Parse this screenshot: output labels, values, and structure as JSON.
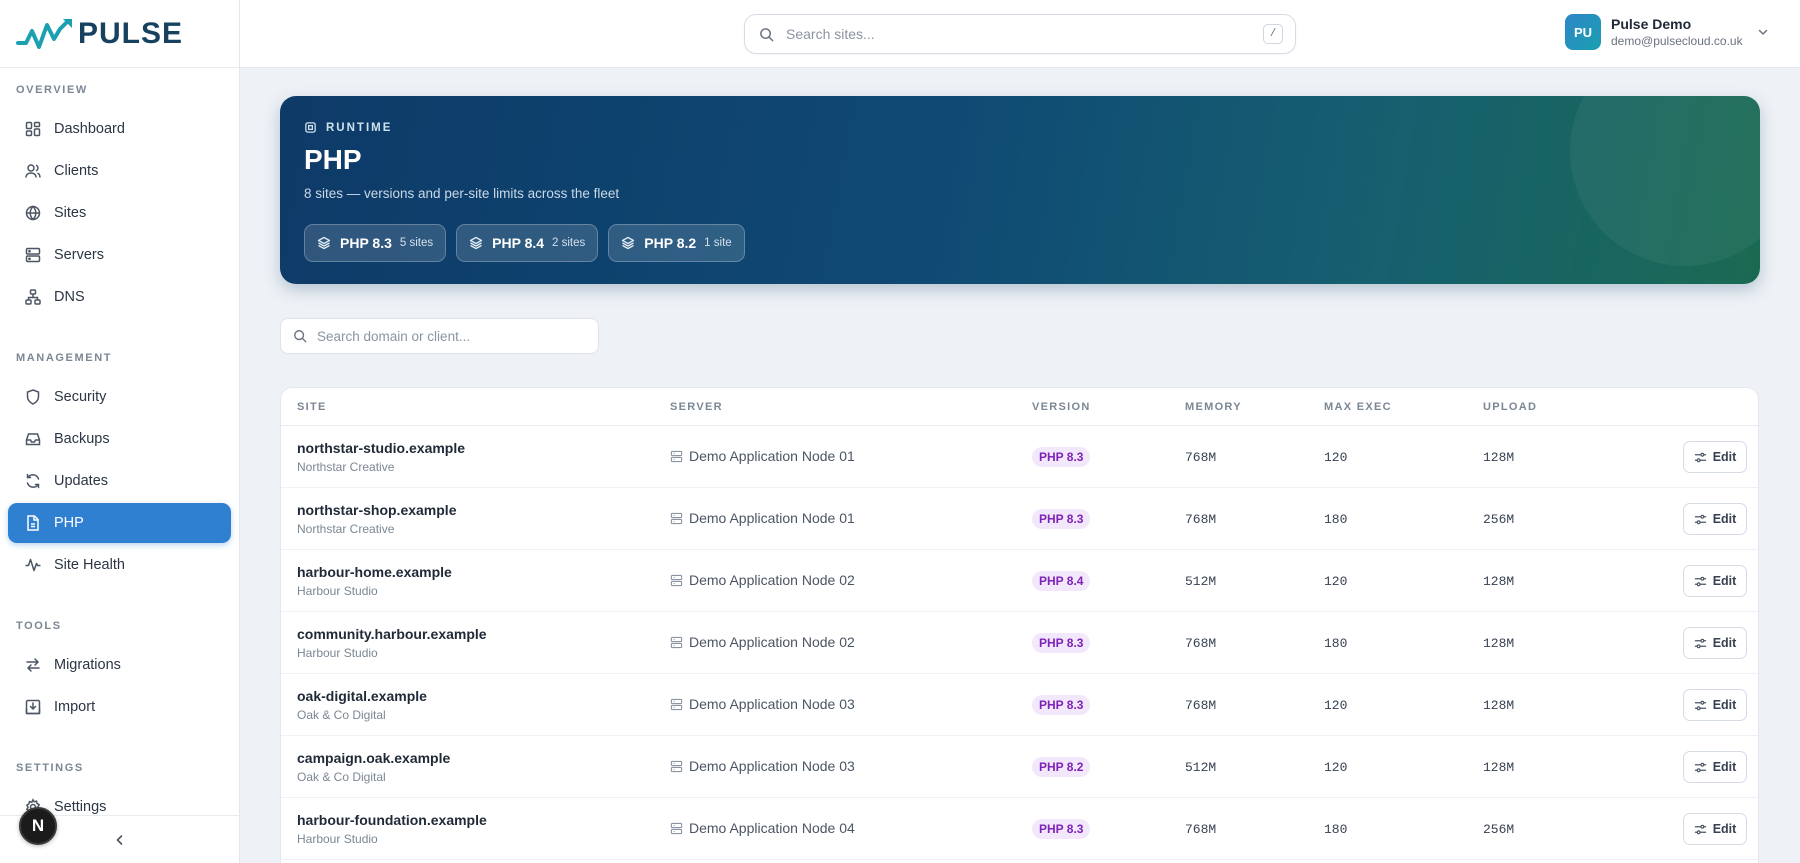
{
  "brand": {
    "name": "PULSE",
    "colors": {
      "primary": "#2f80d1",
      "navy": "#16415f",
      "teal": "#1aa0b0",
      "badge_bg": "#f3e8fb",
      "badge_text": "#7e22b8"
    }
  },
  "sidebar": {
    "sections": [
      {
        "label": "OVERVIEW",
        "items": [
          {
            "label": "Dashboard",
            "icon": "grid-icon"
          },
          {
            "label": "Clients",
            "icon": "users-icon"
          },
          {
            "label": "Sites",
            "icon": "globe-icon"
          },
          {
            "label": "Servers",
            "icon": "server-icon"
          },
          {
            "label": "DNS",
            "icon": "network-icon"
          }
        ]
      },
      {
        "label": "MANAGEMENT",
        "items": [
          {
            "label": "Security",
            "icon": "shield-icon"
          },
          {
            "label": "Backups",
            "icon": "archive-icon"
          },
          {
            "label": "Updates",
            "icon": "refresh-icon"
          },
          {
            "label": "PHP",
            "icon": "file-code-icon",
            "active": true
          },
          {
            "label": "Site Health",
            "icon": "activity-icon"
          }
        ]
      },
      {
        "label": "TOOLS",
        "items": [
          {
            "label": "Migrations",
            "icon": "arrows-swap-icon"
          },
          {
            "label": "Import",
            "icon": "import-icon"
          }
        ]
      },
      {
        "label": "SETTINGS",
        "items": [
          {
            "label": "Settings",
            "icon": "gear-icon"
          }
        ]
      }
    ],
    "footer_badge": "N"
  },
  "topbar": {
    "search_placeholder": "Search sites...",
    "shortcut": "/",
    "user": {
      "initials": "PU",
      "name": "Pulse Demo",
      "email": "demo@pulsecloud.co.uk"
    }
  },
  "hero": {
    "eyebrow": "RUNTIME",
    "title": "PHP",
    "subtitle": "8 sites — versions and per-site limits across the fleet",
    "chips": [
      {
        "version": "PHP 8.3",
        "count": "5 sites"
      },
      {
        "version": "PHP 8.4",
        "count": "2 sites"
      },
      {
        "version": "PHP 8.2",
        "count": "1 site"
      }
    ]
  },
  "filter": {
    "placeholder": "Search domain or client..."
  },
  "table": {
    "columns": [
      "SITE",
      "SERVER",
      "VERSION",
      "MEMORY",
      "MAX EXEC",
      "UPLOAD"
    ],
    "edit_label": "Edit",
    "rows": [
      {
        "domain": "northstar-studio.example",
        "client": "Northstar Creative",
        "server": "Demo Application Node 01",
        "version": "PHP 8.3",
        "memory": "768M",
        "max_exec": "120",
        "upload": "128M"
      },
      {
        "domain": "northstar-shop.example",
        "client": "Northstar Creative",
        "server": "Demo Application Node 01",
        "version": "PHP 8.3",
        "memory": "768M",
        "max_exec": "180",
        "upload": "256M"
      },
      {
        "domain": "harbour-home.example",
        "client": "Harbour Studio",
        "server": "Demo Application Node 02",
        "version": "PHP 8.4",
        "memory": "512M",
        "max_exec": "120",
        "upload": "128M"
      },
      {
        "domain": "community.harbour.example",
        "client": "Harbour Studio",
        "server": "Demo Application Node 02",
        "version": "PHP 8.3",
        "memory": "768M",
        "max_exec": "180",
        "upload": "128M"
      },
      {
        "domain": "oak-digital.example",
        "client": "Oak & Co Digital",
        "server": "Demo Application Node 03",
        "version": "PHP 8.3",
        "memory": "768M",
        "max_exec": "120",
        "upload": "128M"
      },
      {
        "domain": "campaign.oak.example",
        "client": "Oak & Co Digital",
        "server": "Demo Application Node 03",
        "version": "PHP 8.2",
        "memory": "512M",
        "max_exec": "120",
        "upload": "128M"
      },
      {
        "domain": "harbour-foundation.example",
        "client": "Harbour Studio",
        "server": "Demo Application Node 04",
        "version": "PHP 8.3",
        "memory": "768M",
        "max_exec": "180",
        "upload": "256M"
      }
    ]
  }
}
